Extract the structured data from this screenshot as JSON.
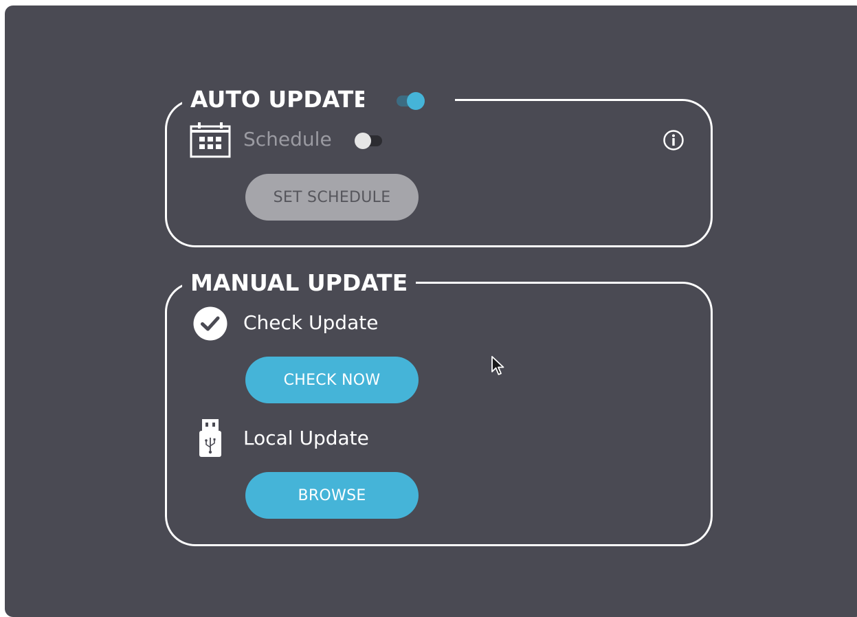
{
  "auto_update": {
    "title": "AUTO UPDATE",
    "enabled": true,
    "schedule_label": "Schedule",
    "schedule_enabled": false,
    "set_schedule_button": "SET SCHEDULE",
    "icons": {
      "schedule": "calendar-icon",
      "info": "info-icon"
    }
  },
  "manual_update": {
    "title": "MANUAL UPDATE",
    "check_label": "Check Update",
    "check_button": "CHECK NOW",
    "local_label": "Local Update",
    "browse_button": "BROWSE",
    "icons": {
      "check": "checkmark-circle-icon",
      "local": "usb-drive-icon"
    }
  },
  "colors": {
    "panel_bg": "#4a4a53",
    "accent": "#45b4d8",
    "disabled_button": "#a5a5aa",
    "text": "#ffffff",
    "dim_text": "#9b9ba2"
  }
}
